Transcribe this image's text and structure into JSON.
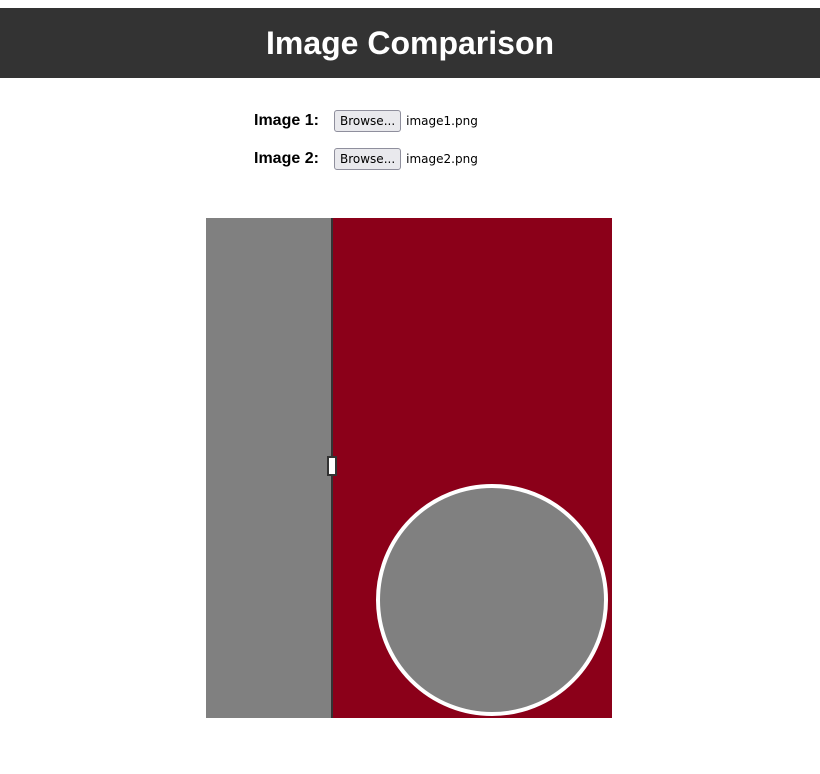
{
  "header": {
    "title": "Image Comparison"
  },
  "inputs": [
    {
      "label": "Image 1:",
      "button_label": "Browse...",
      "file_name": "image1.png"
    },
    {
      "label": "Image 2:",
      "button_label": "Browse...",
      "file_name": "image2.png"
    }
  ],
  "comparison": {
    "slider_fraction": 0.31,
    "colors": {
      "image1_bg": "#808080",
      "image2_bg": "#8b0019",
      "circle_fill": "#808080",
      "circle_stroke": "#ffffff",
      "divider": "#333333"
    }
  }
}
